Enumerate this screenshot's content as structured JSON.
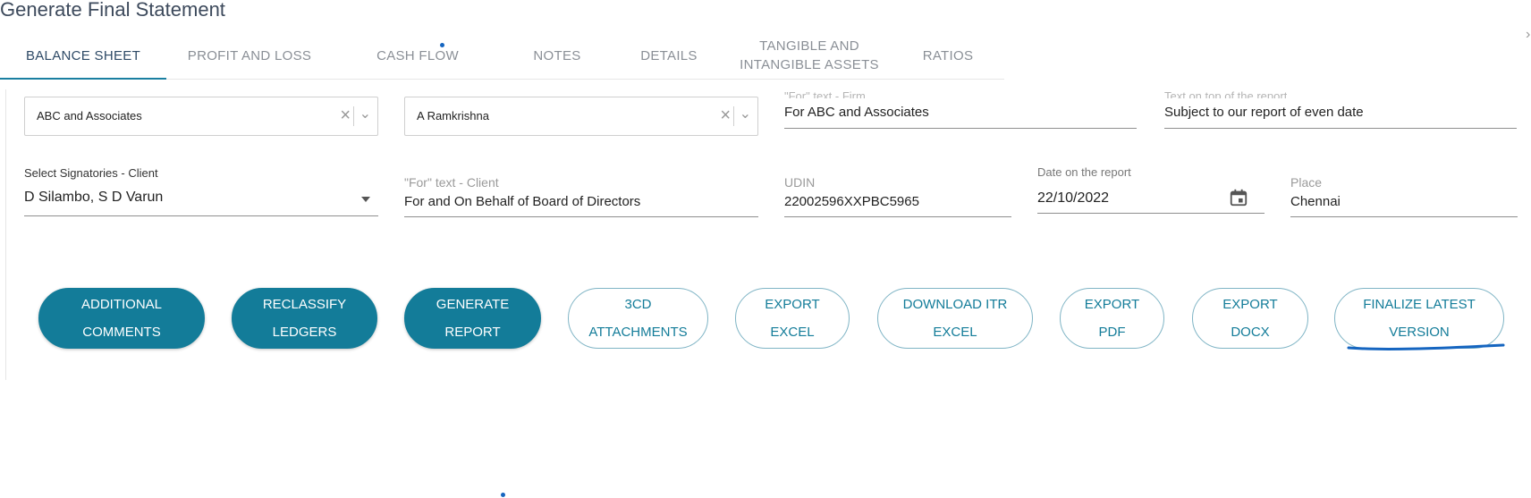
{
  "page": {
    "title": "Generate Final Statement"
  },
  "tabs": [
    {
      "label": "BALANCE SHEET",
      "active": true
    },
    {
      "label": "PROFIT AND LOSS",
      "active": false
    },
    {
      "label": "CASH FLOW",
      "active": false
    },
    {
      "label": "NOTES",
      "active": false
    },
    {
      "label": "DETAILS",
      "active": false
    },
    {
      "label_line1": "TANGIBLE AND",
      "label_line2": "INTANGIBLE ASSETS",
      "active": false
    },
    {
      "label": "RATIOS",
      "active": false
    }
  ],
  "form": {
    "firm_signatory_select": {
      "value": "ABC and Associates"
    },
    "partner_select": {
      "value": "A Ramkrishna"
    },
    "for_text_firm": {
      "label": "\"For\" text - Firm",
      "value": "For ABC and Associates"
    },
    "text_on_top": {
      "label": "Text on top of the report",
      "value": "Subject to our report of even date"
    },
    "signatories_client": {
      "label": "Select Signatories - Client",
      "value": "D Silambo, S D Varun"
    },
    "for_text_client": {
      "label": "\"For\" text - Client",
      "value": "For and On Behalf of Board of Directors"
    },
    "udin": {
      "label": "UDIN",
      "value": "22002596XXPBC5965"
    },
    "report_date": {
      "label": "Date on the report",
      "value": "22/10/2022"
    },
    "place": {
      "label": "Place",
      "value": "Chennai"
    }
  },
  "buttons": {
    "additional_comments": {
      "line1": "ADDITIONAL",
      "line2": "COMMENTS"
    },
    "reclassify_ledgers": {
      "line1": "RECLASSIFY",
      "line2": "LEDGERS"
    },
    "generate_report": {
      "line1": "GENERATE",
      "line2": "REPORT"
    },
    "attachments_3cd": {
      "line1": "3CD",
      "line2": "ATTACHMENTS"
    },
    "export_excel": {
      "line1": "EXPORT",
      "line2": "EXCEL"
    },
    "download_itr_excel": {
      "line1": "DOWNLOAD ITR",
      "line2": "EXCEL"
    },
    "export_pdf": {
      "line1": "EXPORT",
      "line2": "PDF"
    },
    "export_docx": {
      "line1": "EXPORT",
      "line2": "DOCX"
    },
    "finalize_latest_version": {
      "line1": "FINALIZE LATEST",
      "line2": "VERSION"
    }
  },
  "icons": {
    "clear": "close-icon",
    "chevron": "chevron-down-icon",
    "dropdown": "caret-down-icon",
    "calendar": "calendar-icon"
  },
  "colors": {
    "accent": "#137c99",
    "tab_active": "#2e4a66",
    "tab_inactive": "#8a8f96",
    "annotation": "#1565c0"
  }
}
